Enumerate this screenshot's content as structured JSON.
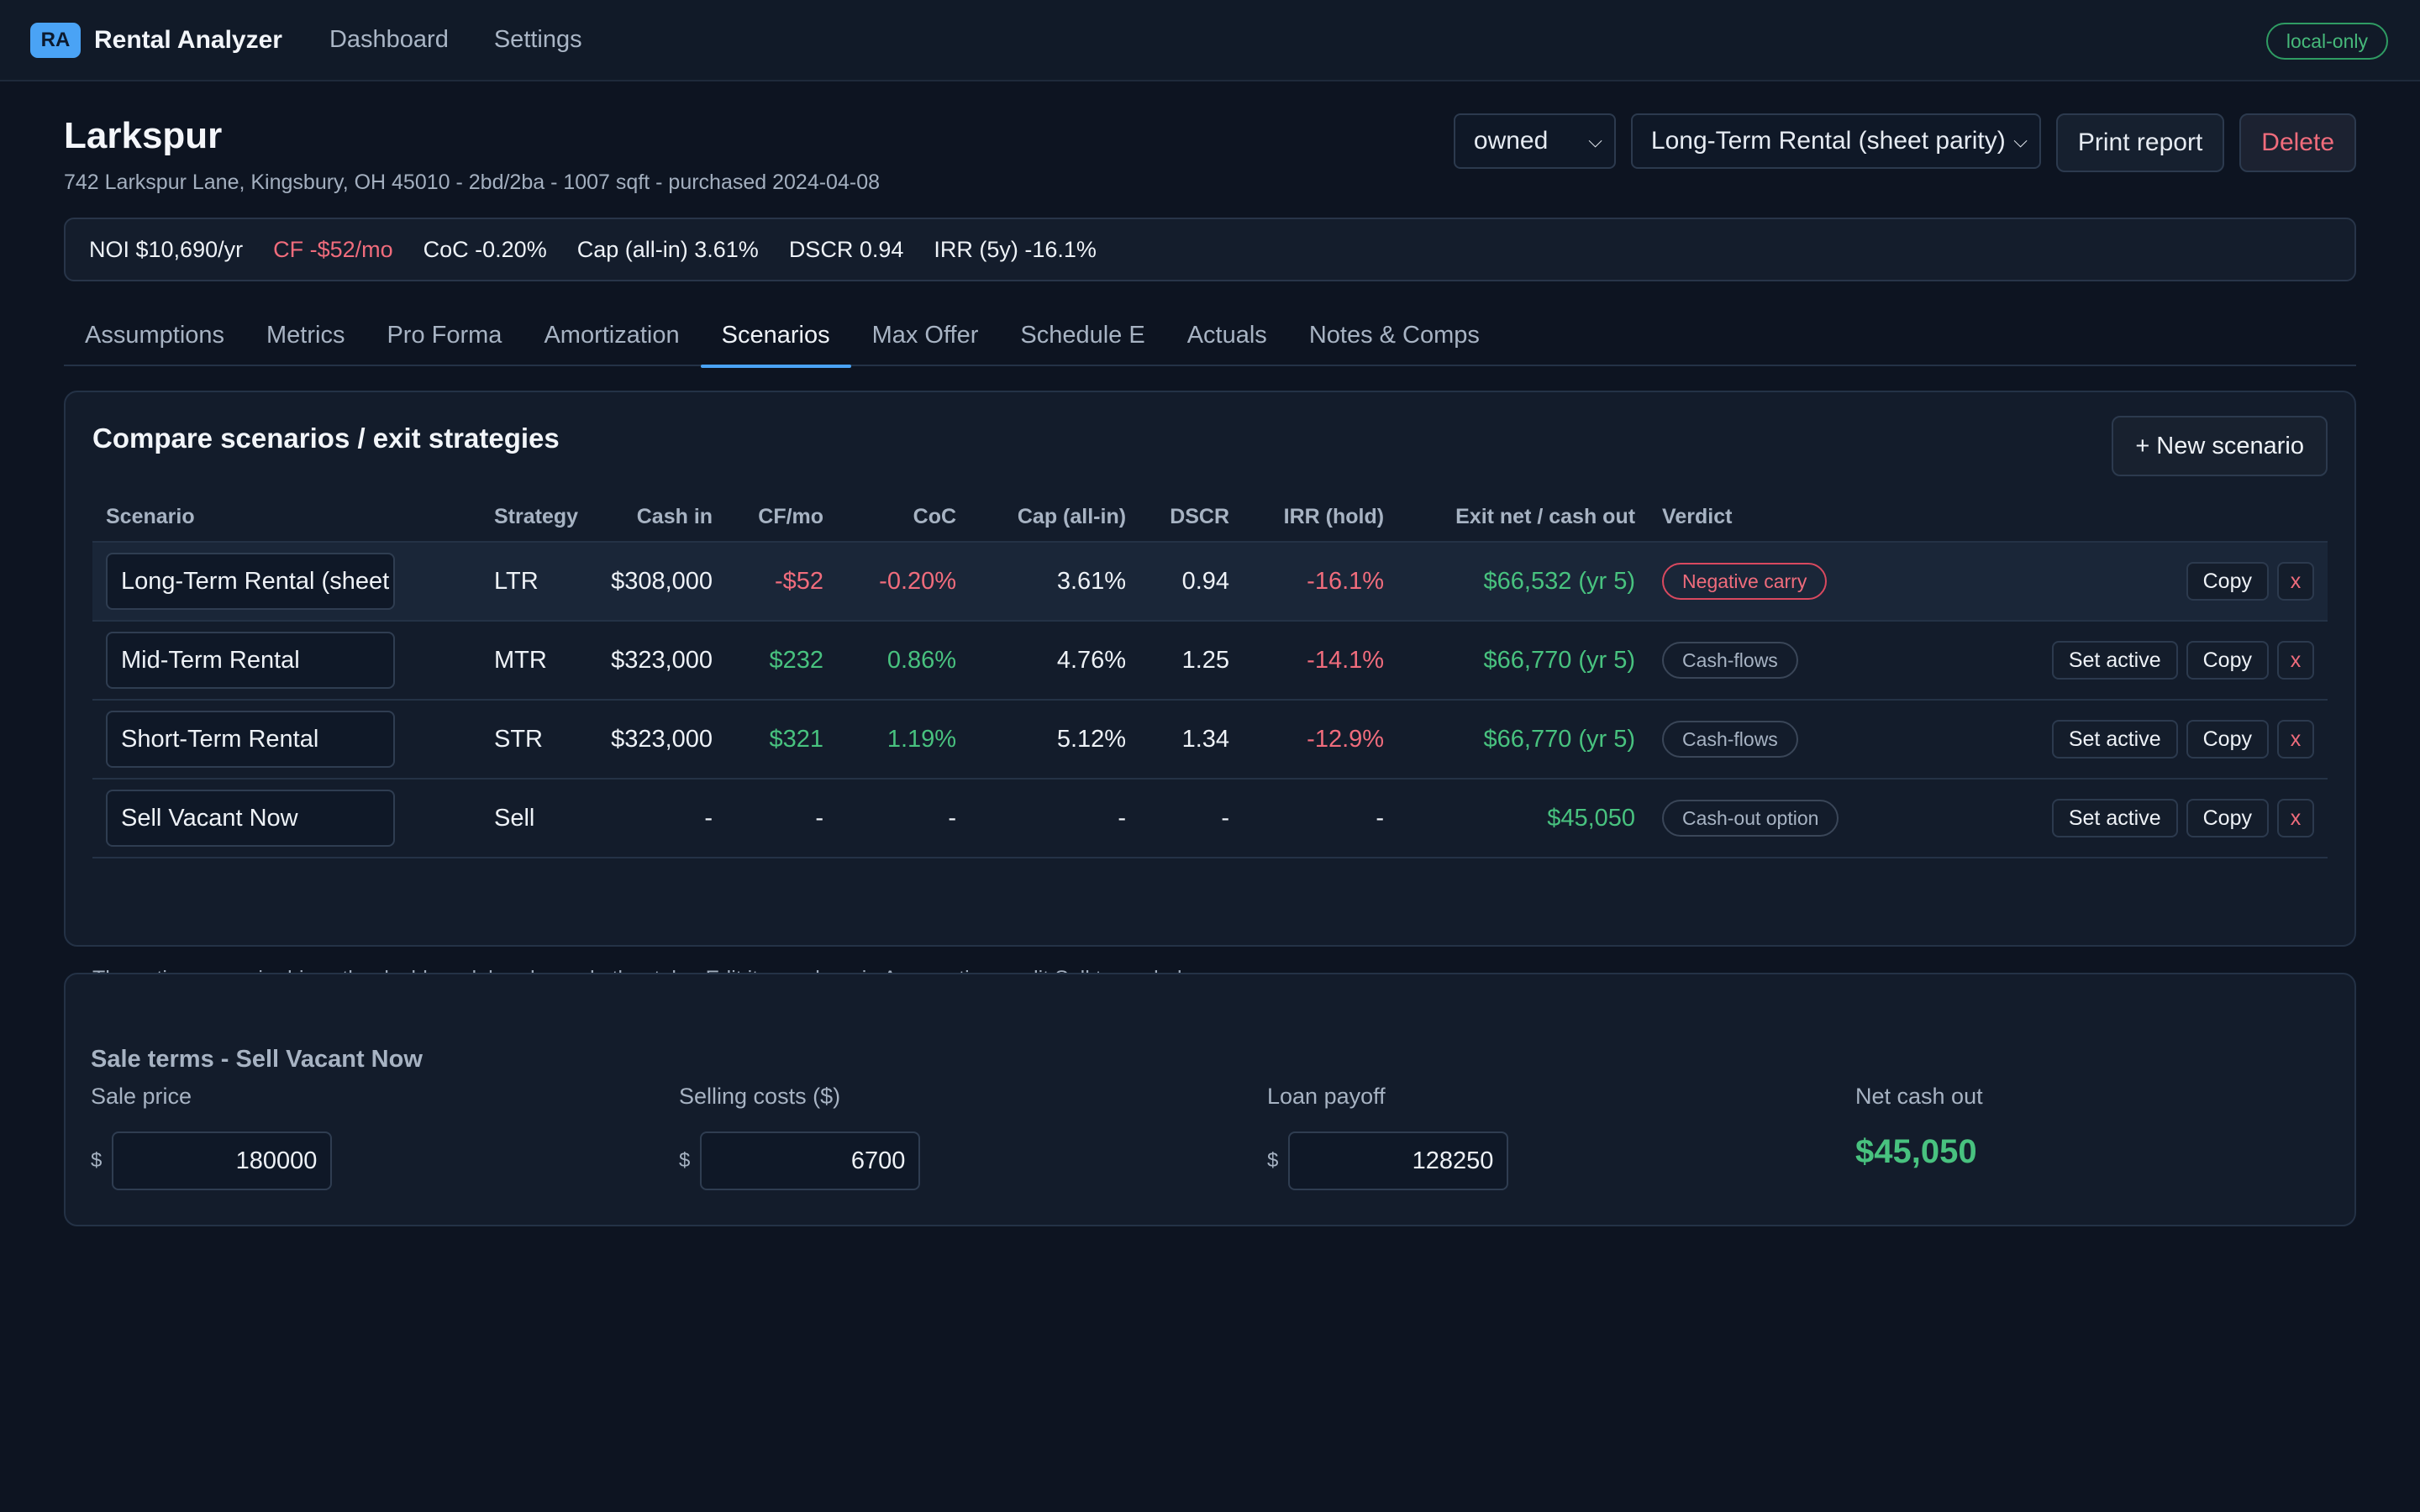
{
  "app": {
    "logo": "RA",
    "name": "Rental Analyzer",
    "nav": [
      "Dashboard",
      "Settings"
    ],
    "mode_badge": "local-only"
  },
  "property": {
    "title": "Larkspur",
    "subtitle": "742 Larkspur Lane, Kingsbury, OH 45010 - 2bd/2ba - 1007 sqft - purchased 2024-04-08",
    "status_select": "owned",
    "scenario_select": "Long-Term Rental (sheet parity)",
    "print_label": "Print report",
    "delete_label": "Delete"
  },
  "metrics": [
    "NOI $10,690/yr",
    "CF -$52/mo",
    "CoC -0.20%",
    "Cap (all-in) 3.61%",
    "DSCR 0.94",
    "IRR (5y) -16.1%"
  ],
  "tabs": [
    "Assumptions",
    "Metrics",
    "Pro Forma",
    "Amortization",
    "Scenarios",
    "Max Offer",
    "Schedule E",
    "Actuals",
    "Notes & Comps"
  ],
  "active_tab": "Scenarios",
  "scenarios": {
    "title": "Compare scenarios / exit strategies",
    "new_label": "+ New scenario",
    "columns": [
      "Scenario",
      "Strategy",
      "Cash in",
      "CF/mo",
      "CoC",
      "Cap (all-in)",
      "DSCR",
      "IRR (hold)",
      "Exit net / cash out",
      "Verdict"
    ],
    "rows": [
      {
        "name": "Long-Term Rental (sheet parity)",
        "strategy": "LTR",
        "cash_in": "$308,000",
        "cf": "-$52",
        "coc": "-0.20%",
        "cap": "3.61%",
        "dscr": "0.94",
        "irr": "-16.1%",
        "exit": "$66,532 (yr 5)",
        "verdict": "Negative carry",
        "set_active": "",
        "copy": "Copy",
        "x": "x"
      },
      {
        "name": "Mid-Term Rental",
        "strategy": "MTR",
        "cash_in": "$323,000",
        "cf": "$232",
        "coc": "0.86%",
        "cap": "4.76%",
        "dscr": "1.25",
        "irr": "-14.1%",
        "exit": "$66,770 (yr 5)",
        "verdict": "Cash-flows",
        "set_active": "Set active",
        "copy": "Copy",
        "x": "x"
      },
      {
        "name": "Short-Term Rental",
        "strategy": "STR",
        "cash_in": "$323,000",
        "cf": "$321",
        "coc": "1.19%",
        "cap": "5.12%",
        "dscr": "1.34",
        "irr": "-12.9%",
        "exit": "$66,770 (yr 5)",
        "verdict": "Cash-flows",
        "set_active": "Set active",
        "copy": "Copy",
        "x": "x"
      },
      {
        "name": "Sell Vacant Now",
        "strategy": "Sell",
        "cash_in": "-",
        "cf": "-",
        "coc": "-",
        "cap": "-",
        "dscr": "-",
        "irr": "-",
        "exit": "$45,050",
        "verdict": "Cash-out option",
        "set_active": "Set active",
        "copy": "Copy",
        "x": "x"
      }
    ],
    "note": "The active scenario drives the dashboard, header and other tabs. Edit its numbers in Assumptions; edit Sell terms below."
  },
  "sale": {
    "title": "Sale terms - Sell Vacant Now",
    "currency": "$",
    "sale_price_label": "Sale price",
    "sale_price": "180000",
    "selling_costs_label": "Selling costs ($)",
    "selling_costs": "6700",
    "loan_payoff_label": "Loan payoff",
    "loan_payoff": "128250",
    "net_label": "Net cash out",
    "net_value": "$45,050"
  }
}
